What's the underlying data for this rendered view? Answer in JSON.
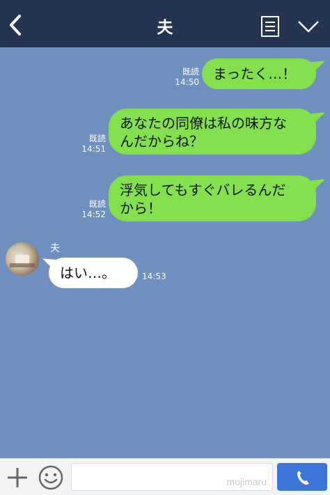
{
  "header": {
    "title": "夫"
  },
  "messages": [
    {
      "text": "まったく…！",
      "status": "既読",
      "time": "14:50"
    },
    {
      "line1": "あなたの同僚は私の味方な",
      "line2": "んだからね？",
      "status": "既読",
      "time": "14:51"
    },
    {
      "line1": "浮気してもすぐバレるんだ",
      "line2": "から！",
      "status": "既読",
      "time": "14:52"
    },
    {
      "sender": "夫",
      "text": "はい…。",
      "time": "14:53"
    }
  ],
  "footer": {
    "watermark": "mojimaru"
  },
  "colors": {
    "header": "#253450",
    "background": "#6f8fbf",
    "my_bubble": "#84e04d",
    "other_bubble": "#ffffff",
    "call_button": "#3d76d8"
  },
  "icons": [
    "back-icon",
    "menu-icon",
    "chevron-down-icon",
    "plus-icon",
    "emoji-icon",
    "phone-icon"
  ]
}
